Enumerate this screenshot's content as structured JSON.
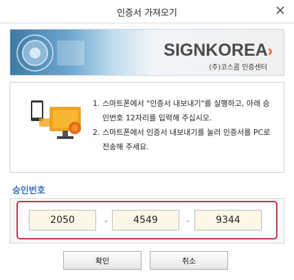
{
  "window": {
    "title": "인증서 가져오기"
  },
  "banner": {
    "logo_text": "SIGNKOREA",
    "subtitle": "(주)코스콤 인증센터"
  },
  "instructions": [
    "스마트폰에서 \"인증서 내보내기\"를 실행하고, 아래 승인번호 12자리를 입력해 주십시오.",
    "스마트폰에서 인증서 내보내기를 눌러 인증서를 PC로 전송해 주세요."
  ],
  "approval": {
    "label": "승인번호",
    "parts": [
      "2050",
      "4549",
      "9344"
    ],
    "separator": "-"
  },
  "buttons": {
    "confirm": "확인",
    "cancel": "취소"
  },
  "colors": {
    "label_blue": "#3a6fb4",
    "highlight_red": "#c2314a",
    "input_bg": "#fdf7e8"
  }
}
